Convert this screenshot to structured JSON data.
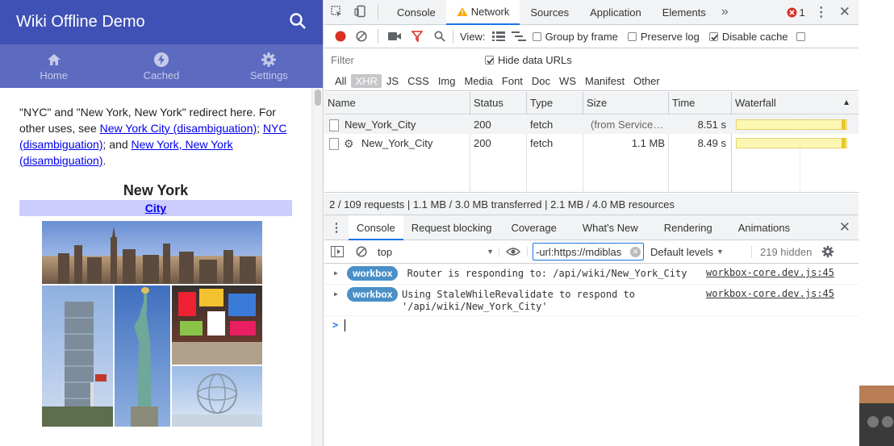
{
  "app": {
    "title": "Wiki Offline Demo",
    "nav": [
      {
        "label": "Home",
        "icon": "home-icon"
      },
      {
        "label": "Cached",
        "icon": "bolt-icon"
      },
      {
        "label": "Settings",
        "icon": "gear-icon"
      }
    ],
    "article": {
      "p1": "\"NYC\" and \"New York, New York\" redirect here. For other uses, see ",
      "link1": "New York City (disambiguation)",
      "p2": "; ",
      "link2": "NYC (disambiguation)",
      "p3": "; and ",
      "link3": "New York, New York (disambiguation)",
      "p4": ".",
      "infobox_title": "New York",
      "infobox_sub": "City"
    }
  },
  "devtools": {
    "tabs": [
      "Console",
      "Network",
      "Sources",
      "Application",
      "Elements"
    ],
    "active_tab": "Network",
    "error_count": "1",
    "netbar": {
      "view_label": "View:",
      "group_by_frame": "Group by frame",
      "preserve_log": "Preserve log",
      "disable_cache": "Disable cache"
    },
    "filter": {
      "placeholder": "Filter",
      "hide_data_urls": "Hide data URLs"
    },
    "types": [
      "All",
      "XHR",
      "JS",
      "CSS",
      "Img",
      "Media",
      "Font",
      "Doc",
      "WS",
      "Manifest",
      "Other"
    ],
    "selected_type": "XHR",
    "columns": [
      "Name",
      "Status",
      "Type",
      "Size",
      "Time",
      "Waterfall"
    ],
    "requests": [
      {
        "name": "New_York_City",
        "status": "200",
        "type": "fetch",
        "size": "(from Service…",
        "time": "8.51 s",
        "gear": false
      },
      {
        "name": "New_York_City",
        "status": "200",
        "type": "fetch",
        "size": "1.1 MB",
        "time": "8.49 s",
        "gear": true
      }
    ],
    "summary": "2 / 109 requests | 1.1 MB / 3.0 MB transferred | 2.1 MB / 4.0 MB resources",
    "drawer_tabs": [
      "Console",
      "Request blocking",
      "Coverage",
      "What's New",
      "Rendering",
      "Animations"
    ],
    "console_bar": {
      "context": "top",
      "filter_value": "-url:https://mdiblas",
      "levels": "Default levels",
      "hidden": "219 hidden"
    },
    "logs": [
      {
        "badge": "workbox",
        "message": "Router is responding to: /api/wiki/New_York_City",
        "source": "workbox-core.dev.js:45"
      },
      {
        "badge": "workbox",
        "message": "Using StaleWhileRevalidate to respond to '/api/wiki/New_York_City'",
        "source": "workbox-core.dev.js:45"
      }
    ],
    "prompt": ">"
  },
  "colors": {
    "appbar": "#3f51b5",
    "navbar": "#5c6bc0",
    "badge": "#4a8fc7",
    "active_tab": "#1a73e8",
    "record": "#d93025"
  }
}
